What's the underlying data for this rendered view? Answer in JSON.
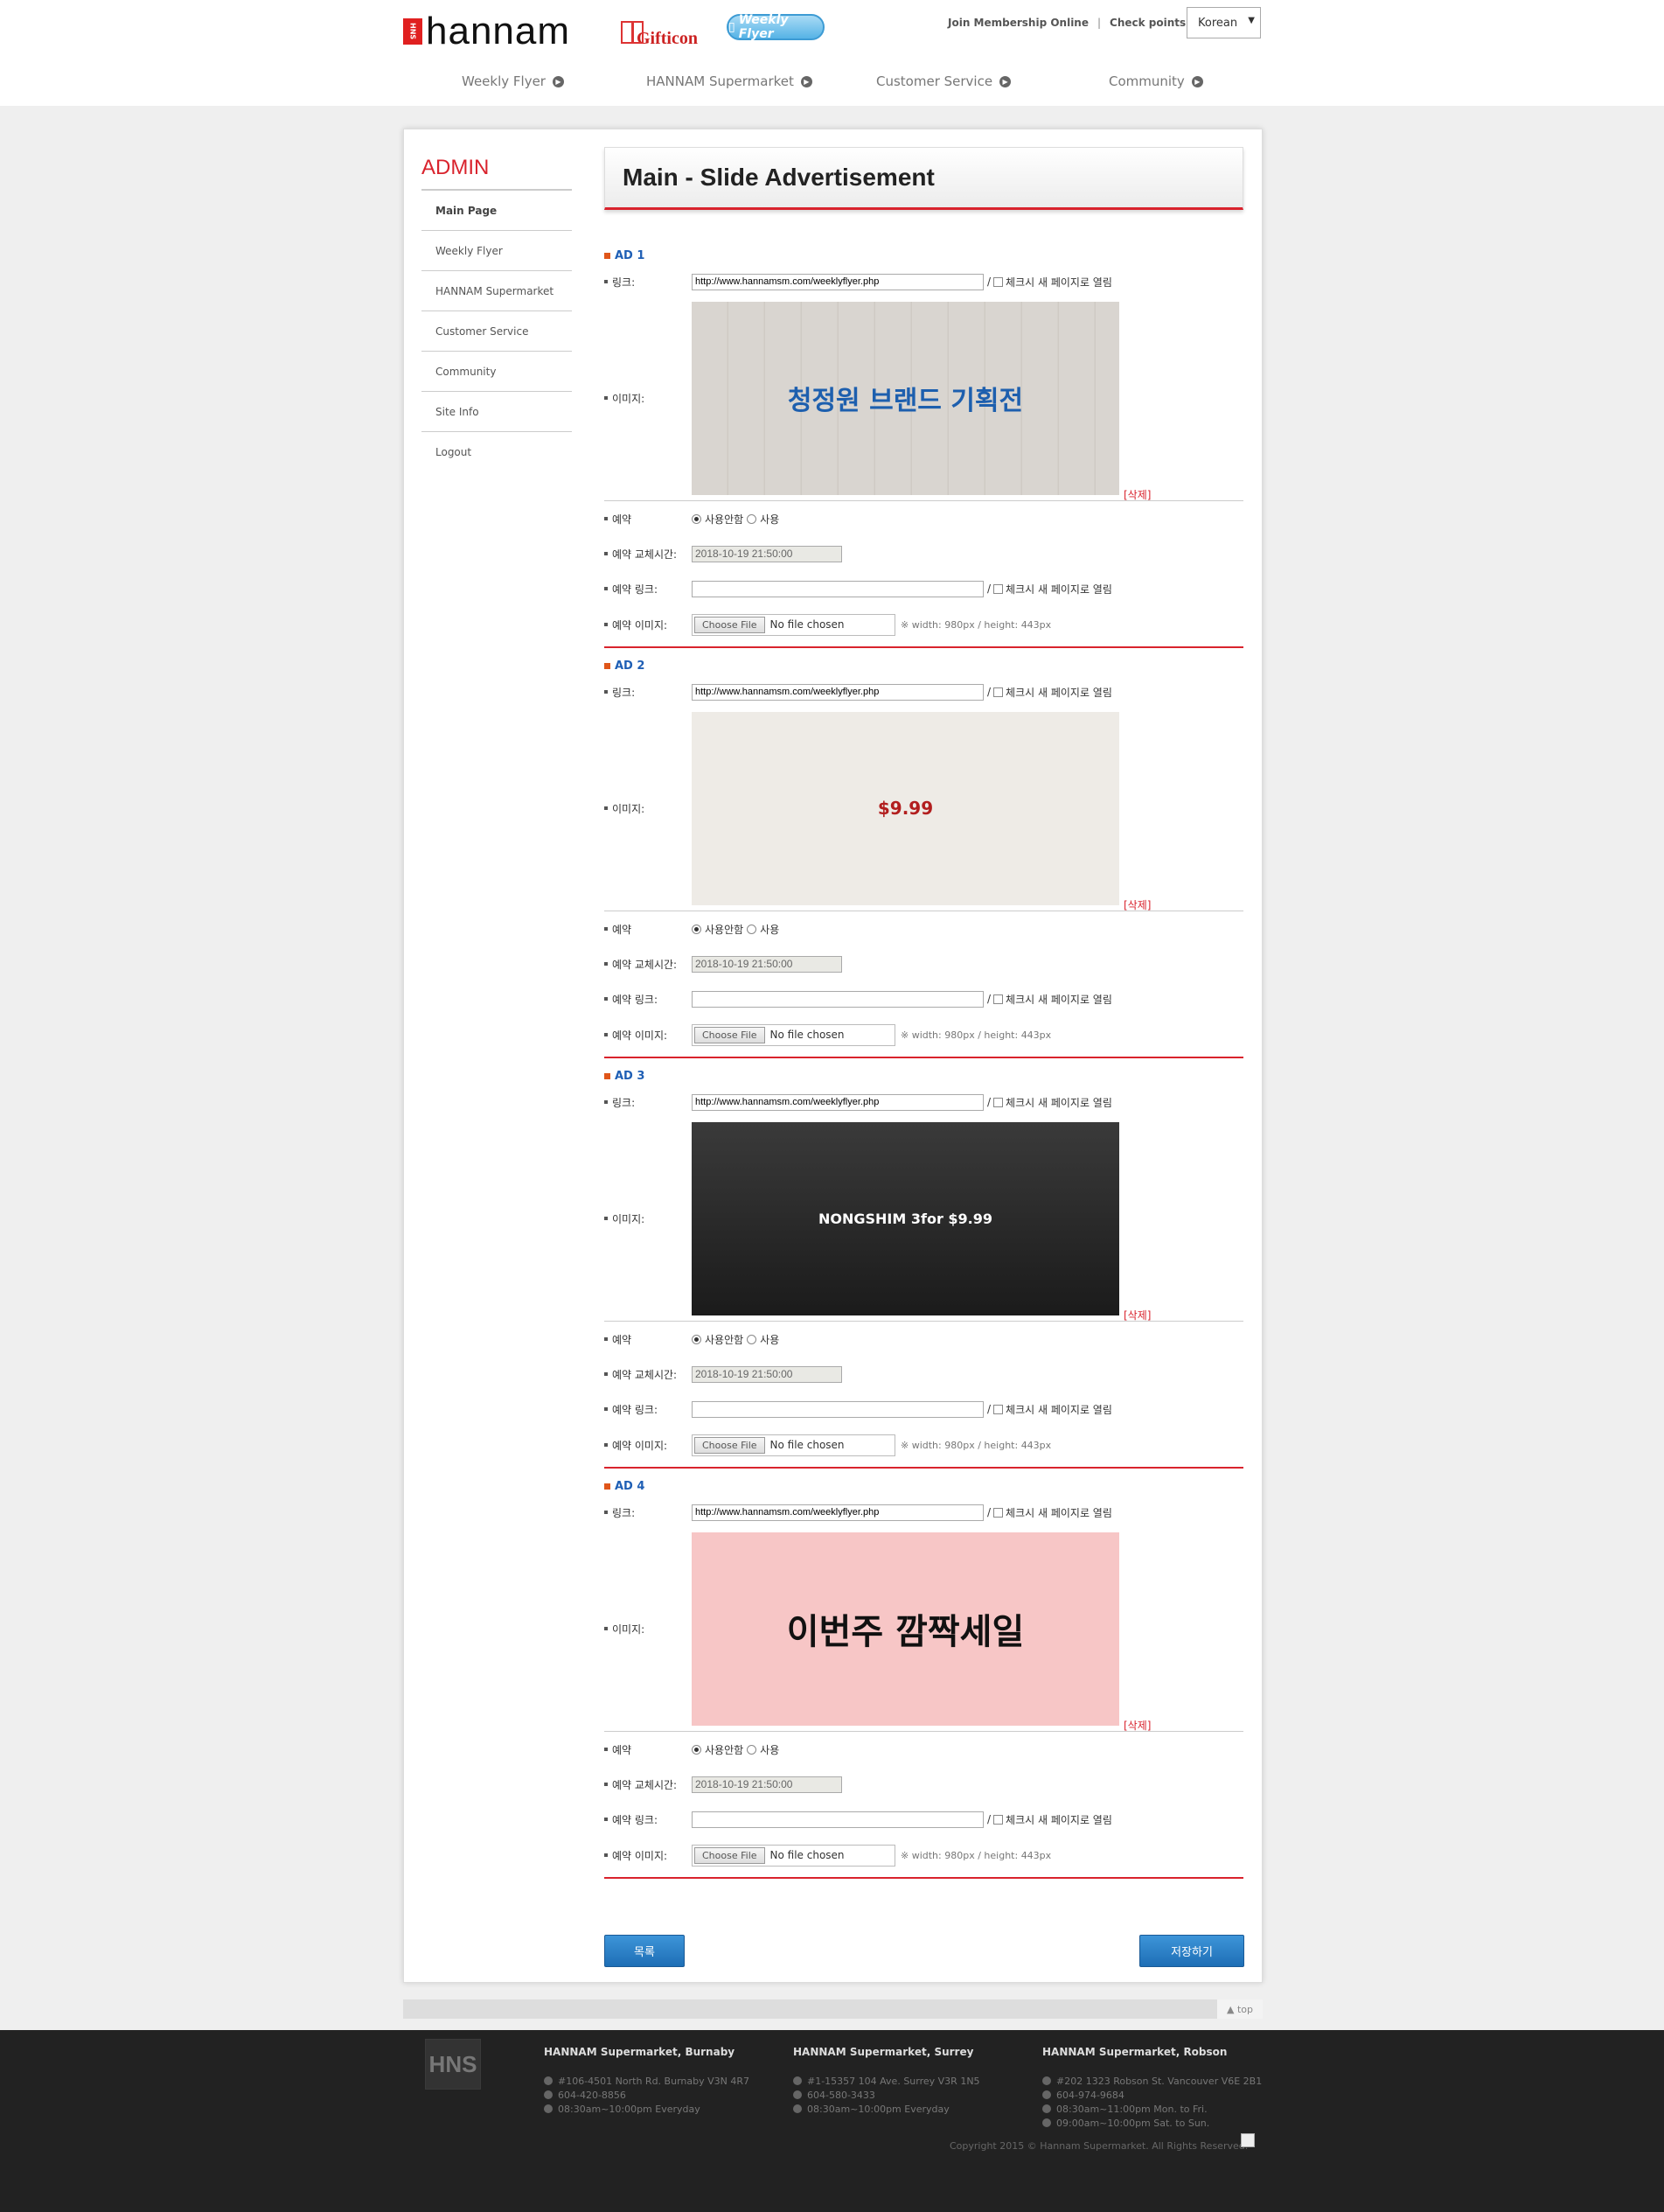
{
  "header": {
    "logo_text": "hannam",
    "logo_mark": "HNS",
    "gifticon_label": "Gifticon",
    "weekly_flyer_pill": "Weekly Flyer",
    "links": [
      "Join Membership Online",
      "Check points"
    ],
    "language": "Korean"
  },
  "nav": [
    "Weekly Flyer",
    "HANNAM Supermarket",
    "Customer Service",
    "Community"
  ],
  "sidebar": {
    "title": "ADMIN",
    "items": [
      "Main Page",
      "Weekly Flyer",
      "HANNAM Supermarket",
      "Customer Service",
      "Community",
      "Site Info",
      "Logout"
    ]
  },
  "page_title": "Main - Slide Advertisement",
  "labels": {
    "link": "링크:",
    "image": "이미지:",
    "reserve": "예약",
    "reserve_time": "예약 교체시간:",
    "reserve_link": "예약 링크:",
    "reserve_image": "예약 이미지:",
    "new_window": "체크시 새 페이지로 열림",
    "delete": "[삭제]",
    "not_use": "사용안함",
    "use": "사용",
    "choose_file": "Choose File",
    "no_file": "No file chosen",
    "size_note": "※ width: 980px / height: 443px"
  },
  "ads": [
    {
      "title": "AD 1",
      "link": "http://www.hannamsm.com/weeklyflyer.php",
      "reserve_time": "2018-10-19 21:50:00",
      "banner": "청정원 브랜드 기획전"
    },
    {
      "title": "AD 2",
      "link": "http://www.hannamsm.com/weeklyflyer.php",
      "reserve_time": "2018-10-19 21:50:00",
      "banner": "$9.99"
    },
    {
      "title": "AD 3",
      "link": "http://www.hannamsm.com/weeklyflyer.php",
      "reserve_time": "2018-10-19 21:50:00",
      "banner": "NONGSHIM 3for $9.99"
    },
    {
      "title": "AD 4",
      "link": "http://www.hannamsm.com/weeklyflyer.php",
      "reserve_time": "2018-10-19 21:50:00",
      "banner": "이번주 깜짝세일"
    }
  ],
  "buttons": {
    "list": "목록",
    "save": "저장하기"
  },
  "top_link": "▲ top",
  "footer": {
    "logo": "HNS",
    "stores": [
      {
        "name": "HANNAM Supermarket, Burnaby",
        "lines": [
          "#106-4501 North Rd. Burnaby V3N 4R7",
          "604-420-8856",
          "08:30am~10:00pm Everyday"
        ]
      },
      {
        "name": "HANNAM Supermarket, Surrey",
        "lines": [
          "#1-15357 104 Ave. Surrey V3R 1N5",
          "604-580-3433",
          "08:30am~10:00pm Everyday"
        ]
      },
      {
        "name": "HANNAM Supermarket, Robson",
        "lines": [
          "#202 1323 Robson St. Vancouver V6E 2B1",
          "604-974-9684",
          "08:30am~11:00pm Mon. to Fri.",
          "09:00am~10:00pm Sat. to Sun."
        ]
      }
    ],
    "copyright": "Copyright 2015 © Hannam Supermarket. All Rights Reserved."
  }
}
